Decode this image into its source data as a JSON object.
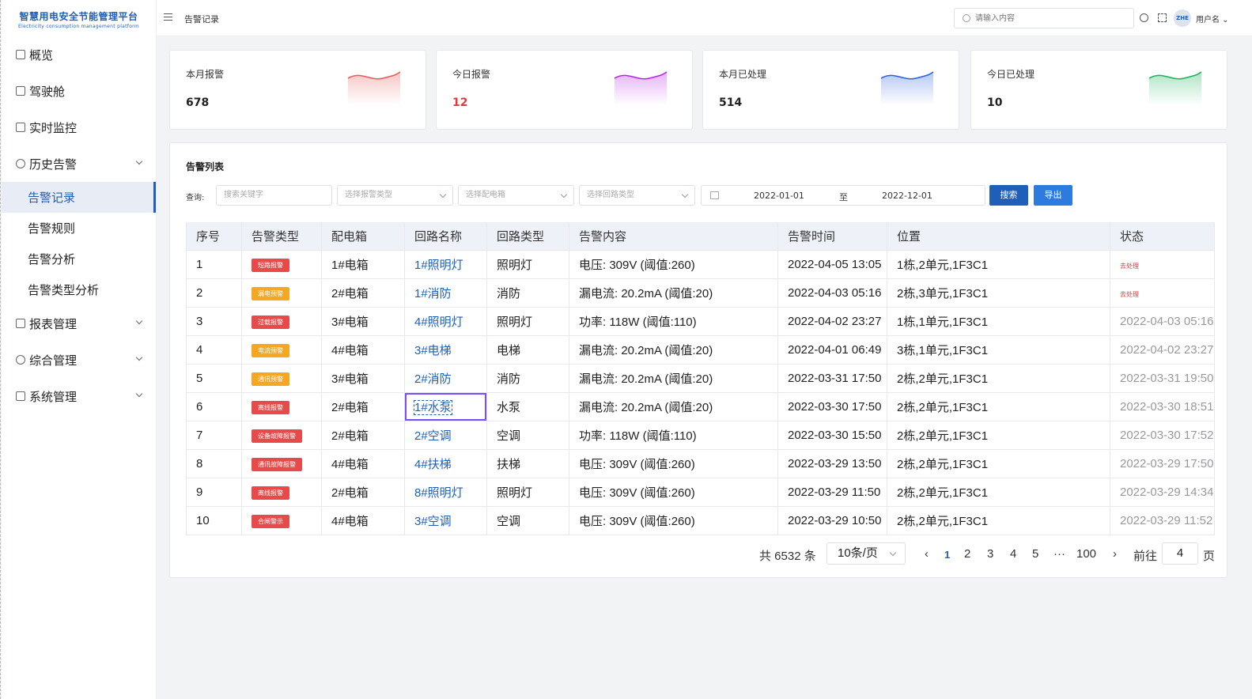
{
  "app": {
    "title_cn": "智慧用电安全节能管理平台",
    "title_en": "Electricity consumption management platform"
  },
  "sidebar": {
    "items": [
      {
        "label": "概览",
        "icon": "chart-icon"
      },
      {
        "label": "驾驶舱",
        "icon": "dashboard-icon"
      },
      {
        "label": "实时监控",
        "icon": "monitor-icon"
      },
      {
        "label": "历史告警",
        "icon": "clock-icon",
        "expanded": true,
        "children": [
          "告警记录",
          "告警规则",
          "告警分析",
          "告警类型分析"
        ]
      },
      {
        "label": "报表管理",
        "icon": "report-icon"
      },
      {
        "label": "综合管理",
        "icon": "gear-icon"
      },
      {
        "label": "系统管理",
        "icon": "system-icon"
      }
    ],
    "active_child": "告警记录"
  },
  "header": {
    "breadcrumb": "告警记录",
    "search_placeholder": "请输入内容",
    "avatar_text": "ZHE",
    "username": "用户名 ⌄"
  },
  "stats": [
    {
      "label": "本月报警",
      "value": "678",
      "color": "#e85a5a"
    },
    {
      "label": "今日报警",
      "value": "12",
      "color": "#b626e8"
    },
    {
      "label": "本月已处理",
      "value": "514",
      "color": "#2a5fe0"
    },
    {
      "label": "今日已处理",
      "value": "10",
      "color": "#18b35a"
    }
  ],
  "panel": {
    "title": "告警列表",
    "query_label": "查询:",
    "keyword_placeholder": "搜索关键字",
    "type_placeholder": "选择报警类型",
    "box_placeholder": "选择配电箱",
    "circuit_placeholder": "选择回路类型",
    "date_from": "2022-01-01",
    "date_sep": "至",
    "date_to": "2022-12-01",
    "search_label": "搜索",
    "export_label": "导出",
    "search_color": "#1f5fb7",
    "export_color": "#2e7bdf"
  },
  "table": {
    "columns": [
      "序号",
      "告警类型",
      "配电箱",
      "回路名称",
      "回路类型",
      "告警内容",
      "告警时间",
      "位置",
      "状态"
    ],
    "rows": [
      {
        "no": "1",
        "type": "短路报警",
        "tag_color": "#e84a4a",
        "box": "1#电箱",
        "circuit": "1#照明灯",
        "ctype": "照明灯",
        "content": "电压: 309V (阈值:260)",
        "time": "2022-04-05 13:05",
        "loc": "1栋,2单元,1F3C1",
        "status": "去处理",
        "todo": true
      },
      {
        "no": "2",
        "type": "漏电预警",
        "tag_color": "#f5a623",
        "box": "2#电箱",
        "circuit": "1#消防",
        "ctype": "消防",
        "content": "漏电流: 20.2mA (阈值:20)",
        "time": "2022-04-03 05:16",
        "loc": "2栋,3单元,1F3C1",
        "status": "去处理",
        "todo": true
      },
      {
        "no": "3",
        "type": "过载报警",
        "tag_color": "#e84a4a",
        "box": "3#电箱",
        "circuit": "4#照明灯",
        "ctype": "照明灯",
        "content": "功率: 118W (阈值:110)",
        "time": "2022-04-02 23:27",
        "loc": "1栋,1单元,1F3C1",
        "status": "2022-04-03 05:16",
        "todo": false
      },
      {
        "no": "4",
        "type": "电流预警",
        "tag_color": "#f5a623",
        "box": "4#电箱",
        "circuit": "3#电梯",
        "ctype": "电梯",
        "content": "漏电流: 20.2mA (阈值:20)",
        "time": "2022-04-01 06:49",
        "loc": "3栋,1单元,1F3C1",
        "status": "2022-04-02 23:27",
        "todo": false
      },
      {
        "no": "5",
        "type": "通讯预警",
        "tag_color": "#f5a623",
        "box": "3#电箱",
        "circuit": "2#消防",
        "ctype": "消防",
        "content": "漏电流: 20.2mA (阈值:20)",
        "time": "2022-03-31 17:50",
        "loc": "2栋,2单元,1F3C1",
        "status": "2022-03-31 19:50",
        "todo": false
      },
      {
        "no": "6",
        "type": "离线报警",
        "tag_color": "#e84a4a",
        "box": "2#电箱",
        "circuit": "1#水泵",
        "ctype": "水泵",
        "content": "漏电流: 20.2mA (阈值:20)",
        "time": "2022-03-30 17:50",
        "loc": "2栋,2单元,1F3C1",
        "status": "2022-03-30 18:51",
        "todo": false,
        "focus": true
      },
      {
        "no": "7",
        "type": "设备故障报警",
        "tag_color": "#e84a4a",
        "box": "2#电箱",
        "circuit": "2#空调",
        "ctype": "空调",
        "content": "功率: 118W (阈值:110)",
        "time": "2022-03-30 15:50",
        "loc": "2栋,2单元,1F3C1",
        "status": "2022-03-30 17:52",
        "todo": false
      },
      {
        "no": "8",
        "type": "通讯故障报警",
        "tag_color": "#e84a4a",
        "box": "4#电箱",
        "circuit": "4#扶梯",
        "ctype": "扶梯",
        "content": "电压: 309V (阈值:260)",
        "time": "2022-03-29 13:50",
        "loc": "2栋,2单元,1F3C1",
        "status": "2022-03-29 17:50",
        "todo": false
      },
      {
        "no": "9",
        "type": "离线报警",
        "tag_color": "#e84a4a",
        "box": "2#电箱",
        "circuit": "8#照明灯",
        "ctype": "照明灯",
        "content": "电压: 309V (阈值:260)",
        "time": "2022-03-29 11:50",
        "loc": "2栋,2单元,1F3C1",
        "status": "2022-03-29 14:34",
        "todo": false
      },
      {
        "no": "10",
        "type": "合闸警示",
        "tag_color": "#e84a4a",
        "box": "4#电箱",
        "circuit": "3#空调",
        "ctype": "空调",
        "content": "电压: 309V (阈值:260)",
        "time": "2022-03-29 10:50",
        "loc": "2栋,2单元,1F3C1",
        "status": "2022-03-29 11:52",
        "todo": false
      }
    ]
  },
  "pagination": {
    "total": "共 6532 条",
    "page_size": "10条/页",
    "prev": "‹",
    "pages": [
      "1",
      "2",
      "3",
      "4",
      "5",
      "···",
      "100"
    ],
    "current": "1",
    "next": "›",
    "goto_label": "前往",
    "goto_value": "4",
    "goto_suffix": "页"
  }
}
